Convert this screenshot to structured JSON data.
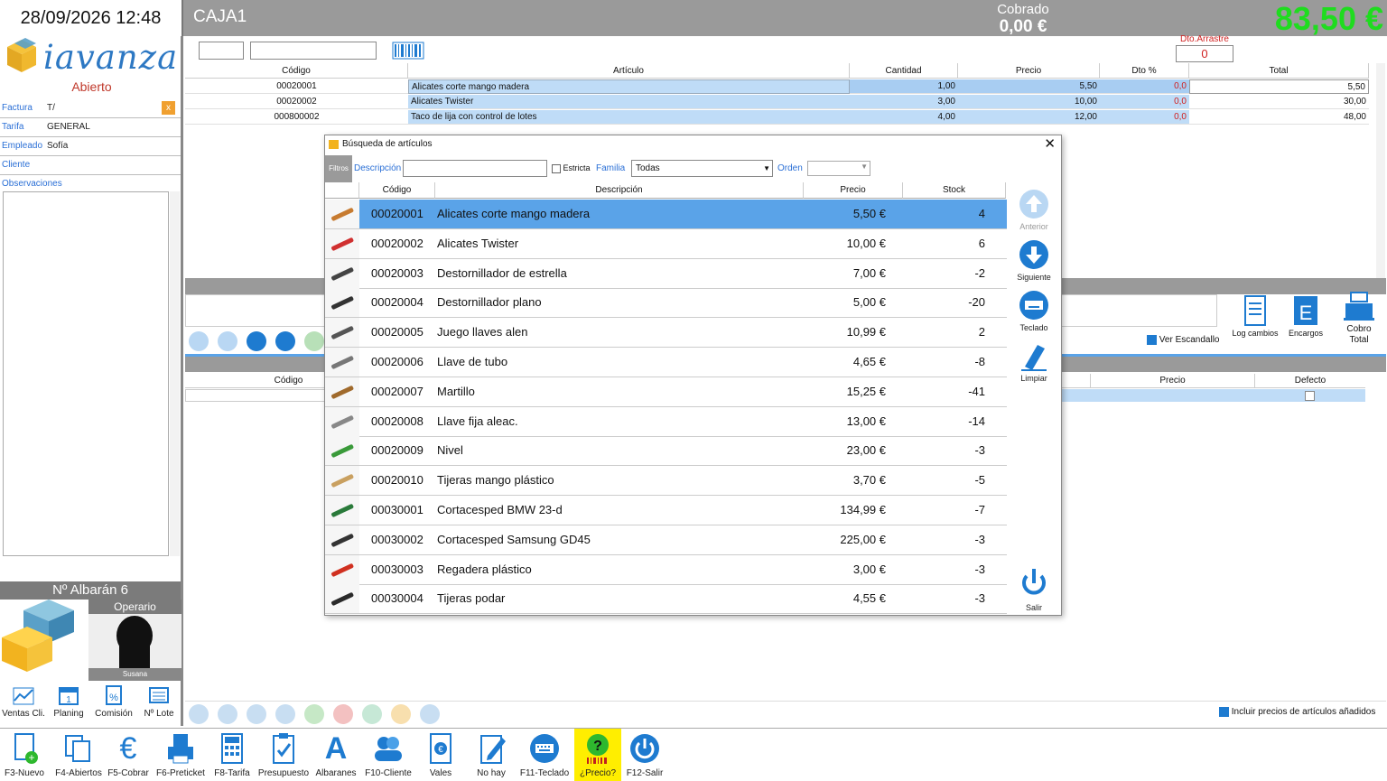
{
  "header": {
    "datetime": "28/09/2026 12:48",
    "caja": "CAJA1",
    "cobrado_label": "Cobrado",
    "cobrado_value": "0,00 €",
    "total": "83,50 €",
    "dto_label": "Dto.Arrastre",
    "dto_value": "0"
  },
  "left": {
    "logo": "iavanza",
    "estado": "Abierto",
    "rows": [
      {
        "k": "Factura",
        "v": "T/"
      },
      {
        "k": "Tarifa",
        "v": "GENERAL"
      },
      {
        "k": "Empleado",
        "v": "Sofía"
      },
      {
        "k": "Cliente",
        "v": ""
      },
      {
        "k": "Observaciones",
        "v": ""
      }
    ],
    "albaran": "Nº Albarán 6",
    "operario_label": "Operario",
    "operario_name": "Susana",
    "buttons": [
      "Ventas Cli.",
      "Planing",
      "Comisión",
      "Nº Lote"
    ]
  },
  "grid": {
    "headers": [
      "Código",
      "Artículo",
      "Cantidad",
      "Precio",
      "Dto %",
      "Total"
    ],
    "rows": [
      {
        "codigo": "00020001",
        "articulo": "Alicates corte mango madera",
        "cantidad": "1,00",
        "precio": "5,50",
        "dto": "0,0",
        "total": "5,50"
      },
      {
        "codigo": "00020002",
        "articulo": "Alicates Twister",
        "cantidad": "3,00",
        "precio": "10,00",
        "dto": "0,0",
        "total": "30,00"
      },
      {
        "codigo": "000800002",
        "articulo": "Taco de lija con control de lotes",
        "cantidad": "4,00",
        "precio": "12,00",
        "dto": "0,0",
        "total": "48,00"
      }
    ]
  },
  "right_panel": {
    "ver_escandallo": "Ver Escandallo",
    "log_cambios": "Log cambios",
    "encargos": "Encargos",
    "cobro_total": "Cobro Total"
  },
  "sub_table": {
    "codigo": "Código",
    "precio": "Precio",
    "defecto": "Defecto",
    "incluir": "Incluir precios de artículos añadidos"
  },
  "dialog": {
    "title": "Búsqueda de artículos",
    "filtros": "Filtros",
    "descripcion_label": "Descripción",
    "estricta": "Estricta",
    "familia_label": "Familia",
    "familia_value": "Todas",
    "orden_label": "Orden",
    "headers": [
      "Código",
      "Descripción",
      "Precio",
      "Stock"
    ],
    "rows": [
      {
        "codigo": "00020001",
        "desc": "Alicates corte mango madera",
        "precio": "5,50 €",
        "stock": "4"
      },
      {
        "codigo": "00020002",
        "desc": "Alicates Twister",
        "precio": "10,00 €",
        "stock": "6"
      },
      {
        "codigo": "00020003",
        "desc": "Destornillador de estrella",
        "precio": "7,00 €",
        "stock": "-2"
      },
      {
        "codigo": "00020004",
        "desc": "Destornillador plano",
        "precio": "5,00 €",
        "stock": "-20"
      },
      {
        "codigo": "00020005",
        "desc": "Juego llaves alen",
        "precio": "10,99 €",
        "stock": "2"
      },
      {
        "codigo": "00020006",
        "desc": "Llave de tubo",
        "precio": "4,65 €",
        "stock": "-8"
      },
      {
        "codigo": "00020007",
        "desc": "Martillo",
        "precio": "15,25 €",
        "stock": "-41"
      },
      {
        "codigo": "00020008",
        "desc": "Llave fija aleac.",
        "precio": "13,00 €",
        "stock": "-14"
      },
      {
        "codigo": "00020009",
        "desc": "Nivel",
        "precio": "23,00 €",
        "stock": "-3"
      },
      {
        "codigo": "00020010",
        "desc": "Tijeras mango plástico",
        "precio": "3,70 €",
        "stock": "-5"
      },
      {
        "codigo": "00030001",
        "desc": "Cortacesped BMW 23-d",
        "precio": "134,99 €",
        "stock": "-7"
      },
      {
        "codigo": "00030002",
        "desc": "Cortacesped Samsung GD45",
        "precio": "225,00 €",
        "stock": "-3"
      },
      {
        "codigo": "00030003",
        "desc": "Regadera plástico",
        "precio": "3,00 €",
        "stock": "-3"
      },
      {
        "codigo": "00030004",
        "desc": "Tijeras podar",
        "precio": "4,55 €",
        "stock": "-3"
      }
    ],
    "side": {
      "anterior": "Anterior",
      "siguiente": "Siguiente",
      "teclado": "Teclado",
      "limpiar": "Limpiar",
      "salir": "Salir"
    }
  },
  "toolbar": [
    "F3-Nuevo",
    "F4-Abiertos",
    "F5-Cobrar",
    "F6-Preticket",
    "F8-Tarifa",
    "Presupuesto",
    "Albaranes",
    "F10-Cliente",
    "Vales",
    "No hay",
    "F11-Teclado",
    "¿Precio?",
    "F12-Salir"
  ]
}
